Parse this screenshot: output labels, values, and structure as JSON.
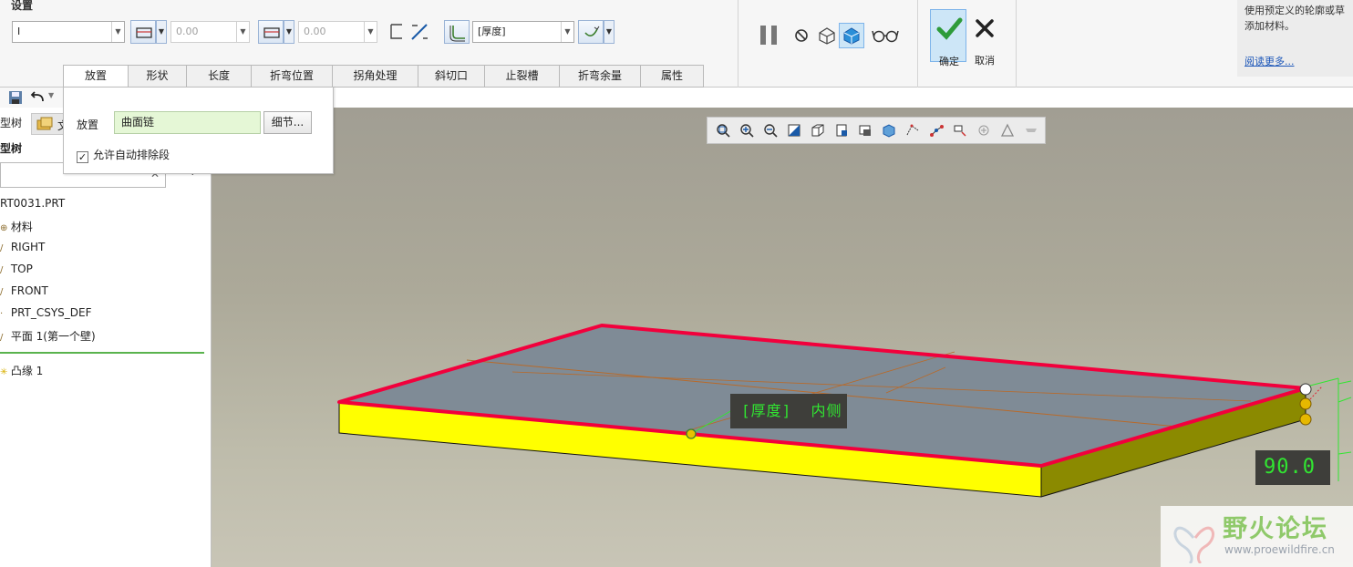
{
  "ribbon": {
    "settings_label": "设置",
    "sketch_select_value": "I",
    "dim_value_1": "0.00",
    "dim_value_2": "0.00",
    "thickness_combo_value": "[厚度]"
  },
  "actions": {
    "ok_label": "确定",
    "cancel_label": "取消"
  },
  "tabs": [
    {
      "label": "放置"
    },
    {
      "label": "形状"
    },
    {
      "label": "长度"
    },
    {
      "label": "折弯位置"
    },
    {
      "label": "拐角处理"
    },
    {
      "label": "斜切口"
    },
    {
      "label": "止裂槽"
    },
    {
      "label": "折弯余量"
    },
    {
      "label": "属性"
    }
  ],
  "placement": {
    "label": "放置",
    "collector_value": "曲面链",
    "details_label": "细节...",
    "auto_exclude_label": "允许自动排除段",
    "auto_exclude_checked": true
  },
  "help": {
    "line1": "使用预定义的轮廓或草",
    "line2": "添加材料。",
    "link": "阅读更多..."
  },
  "left": {
    "tab_label": "型树",
    "tab2_label": "文",
    "title": "型树",
    "search_clear": "✕",
    "tree_items": [
      {
        "label": "RT0031.PRT"
      },
      {
        "label": "材料"
      },
      {
        "label": "RIGHT"
      },
      {
        "label": "TOP"
      },
      {
        "label": "FRONT"
      },
      {
        "label": "PRT_CSYS_DEF"
      },
      {
        "label": "平面 1(第一个壁)"
      },
      {
        "label": "凸缘 1"
      }
    ]
  },
  "graphics": {
    "thickness_label": "[厚度]  内侧",
    "angle_value": "90.0"
  },
  "watermark": {
    "title": "野火论坛",
    "url": "www.proewildfire.cn"
  },
  "colors": {
    "edge_highlight": "#f2003c",
    "side_face": "#ffff00",
    "top_face": "#7f8b96",
    "annotation_text": "#31e631",
    "accent_blue": "#7eb4ea"
  }
}
